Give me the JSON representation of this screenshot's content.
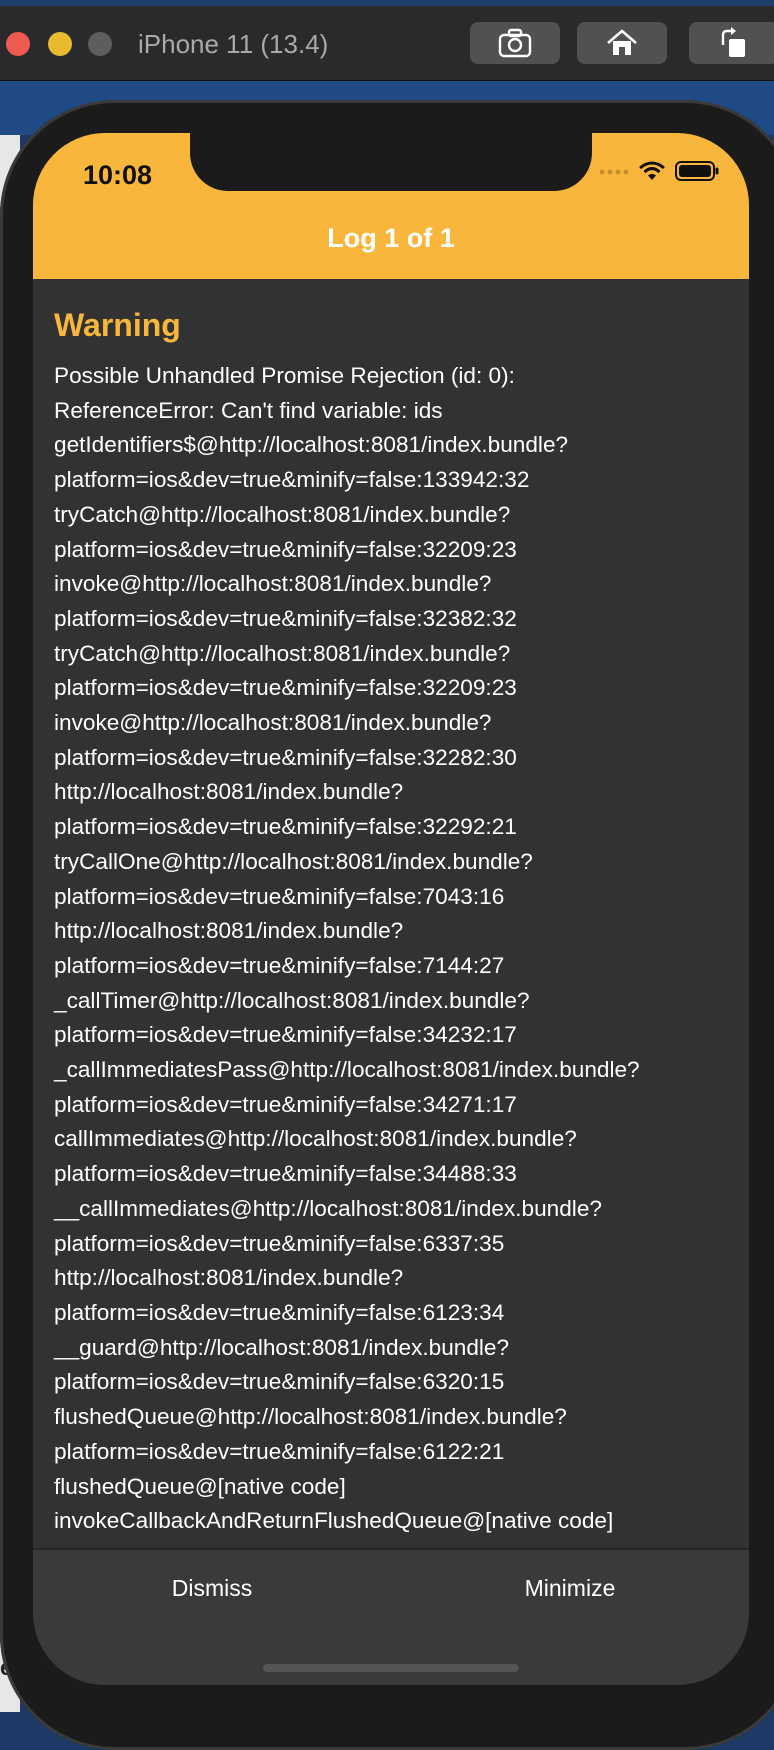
{
  "simulator": {
    "title": "iPhone 11 (13.4)",
    "buttons": [
      "camera-icon",
      "home-icon",
      "rotate-icon"
    ]
  },
  "desktop": {
    "side_text": "ed"
  },
  "status_bar": {
    "time": "10:08"
  },
  "header": {
    "title": "Log 1 of 1"
  },
  "log": {
    "level": "Warning",
    "message": "Possible Unhandled Promise Rejection (id: 0):\nReferenceError: Can't find variable: ids\ngetIdentifiers$@http://localhost:8081/index.bundle?\nplatform=ios&dev=true&minify=false:133942:32\ntryCatch@http://localhost:8081/index.bundle?\nplatform=ios&dev=true&minify=false:32209:23\ninvoke@http://localhost:8081/index.bundle?\nplatform=ios&dev=true&minify=false:32382:32\ntryCatch@http://localhost:8081/index.bundle?\nplatform=ios&dev=true&minify=false:32209:23\ninvoke@http://localhost:8081/index.bundle?\nplatform=ios&dev=true&minify=false:32282:30\nhttp://localhost:8081/index.bundle?\nplatform=ios&dev=true&minify=false:32292:21\ntryCallOne@http://localhost:8081/index.bundle?\nplatform=ios&dev=true&minify=false:7043:16\nhttp://localhost:8081/index.bundle?\nplatform=ios&dev=true&minify=false:7144:27\n_callTimer@http://localhost:8081/index.bundle?\nplatform=ios&dev=true&minify=false:34232:17\n_callImmediatesPass@http://localhost:8081/index.bundle?\nplatform=ios&dev=true&minify=false:34271:17\ncallImmediates@http://localhost:8081/index.bundle?\nplatform=ios&dev=true&minify=false:34488:33\n__callImmediates@http://localhost:8081/index.bundle?\nplatform=ios&dev=true&minify=false:6337:35\nhttp://localhost:8081/index.bundle?\nplatform=ios&dev=true&minify=false:6123:34\n__guard@http://localhost:8081/index.bundle?\nplatform=ios&dev=true&minify=false:6320:15\nflushedQueue@http://localhost:8081/index.bundle?\nplatform=ios&dev=true&minify=false:6122:21\nflushedQueue@[native code]\ninvokeCallbackAndReturnFlushedQueue@[native code]"
  },
  "footer": {
    "dismiss": "Dismiss",
    "minimize": "Minimize"
  },
  "colors": {
    "accent": "#f8b73c",
    "background": "#323232",
    "text": "#ffffff"
  }
}
